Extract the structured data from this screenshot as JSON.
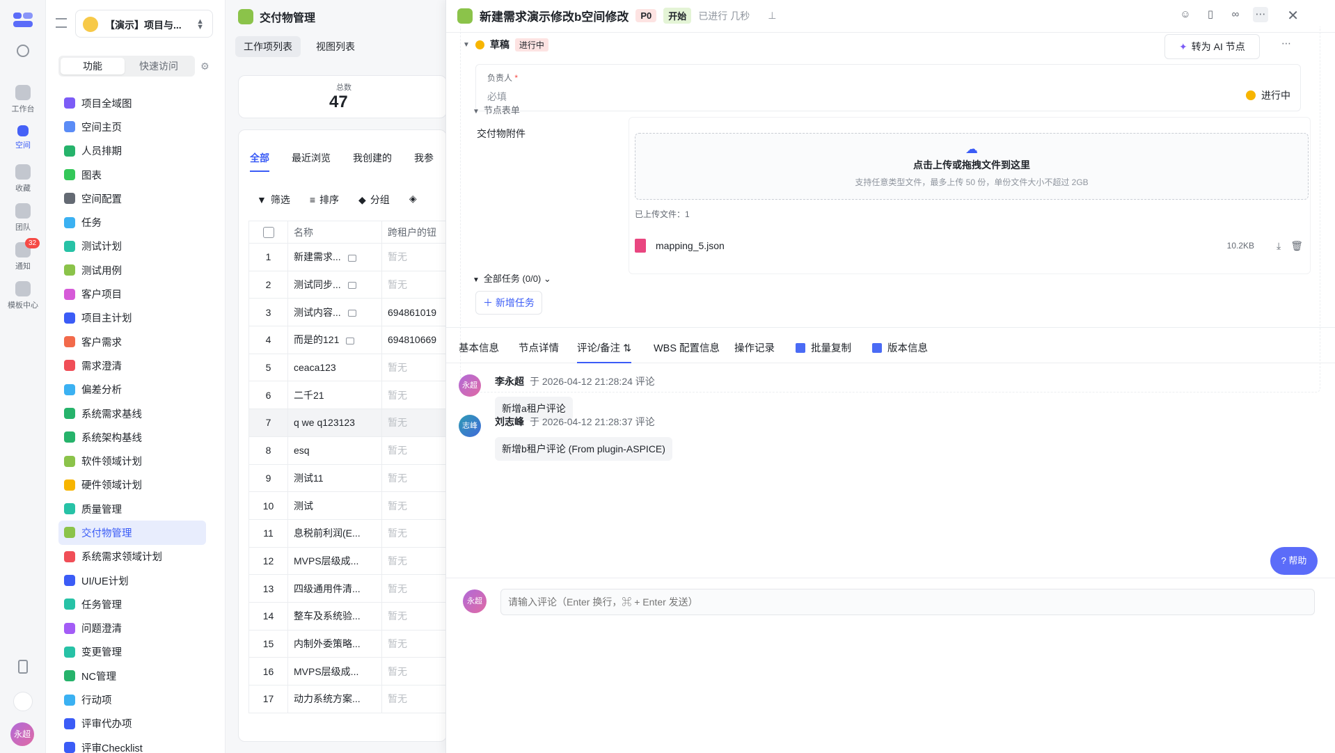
{
  "rail": {
    "items": [
      {
        "label": "",
        "icon": "search-icon"
      },
      {
        "label": "工作台",
        "icon": "home-icon"
      },
      {
        "label": "空间",
        "icon": "space-icon"
      },
      {
        "label": "收藏",
        "icon": "star-icon"
      },
      {
        "label": "团队",
        "icon": "team-icon"
      },
      {
        "label": "通知",
        "icon": "bell-icon",
        "badge": "32"
      },
      {
        "label": "模板中心",
        "icon": "template-icon"
      }
    ],
    "avatar": "永超"
  },
  "nav": {
    "project": "【演示】项目与...",
    "seg_on": "功能",
    "seg_off": "快速访问",
    "items": [
      {
        "label": "项目全域图",
        "color": "#7c5cf6"
      },
      {
        "label": "空间主页",
        "color": "#5b8cf6"
      },
      {
        "label": "人员排期",
        "color": "#26b36b"
      },
      {
        "label": "图表",
        "color": "#34c759"
      },
      {
        "label": "空间配置",
        "color": "#646a73"
      },
      {
        "label": "任务",
        "color": "#3bb1f2"
      },
      {
        "label": "测试计划",
        "color": "#27c2a6"
      },
      {
        "label": "测试用例",
        "color": "#8bc34a"
      },
      {
        "label": "客户项目",
        "color": "#d65ad8"
      },
      {
        "label": "项目主计划",
        "color": "#3b5cf6"
      },
      {
        "label": "客户需求",
        "color": "#f26a4b"
      },
      {
        "label": "需求澄清",
        "color": "#f04e57"
      },
      {
        "label": "偏差分析",
        "color": "#3bb1f2"
      },
      {
        "label": "系统需求基线",
        "color": "#26b36b"
      },
      {
        "label": "系统架构基线",
        "color": "#26b36b"
      },
      {
        "label": "软件领域计划",
        "color": "#8bc34a"
      },
      {
        "label": "硬件领域计划",
        "color": "#f7b500"
      },
      {
        "label": "质量管理",
        "color": "#27c2a6"
      },
      {
        "label": "交付物管理",
        "color": "#8bc34a",
        "active": true
      },
      {
        "label": "系统需求领域计划",
        "color": "#f04e57"
      },
      {
        "label": "UI/UE计划",
        "color": "#3b5cf6"
      },
      {
        "label": "任务管理",
        "color": "#27c2a6"
      },
      {
        "label": "问题澄清",
        "color": "#a35cf6"
      },
      {
        "label": "变更管理",
        "color": "#27c2a6"
      },
      {
        "label": "NC管理",
        "color": "#26b36b"
      },
      {
        "label": "行动项",
        "color": "#3bb1f2"
      },
      {
        "label": "评审代办项",
        "color": "#3b5cf6"
      },
      {
        "label": "评审Checklist",
        "color": "#3b5cf6"
      }
    ]
  },
  "mid": {
    "title": "交付物管理",
    "tabs": [
      "工作项列表",
      "视图列表"
    ],
    "total_label": "总数",
    "total": "47",
    "filter_tabs": [
      "全部",
      "最近浏览",
      "我创建的",
      "我参"
    ],
    "tools": {
      "filter": "筛选",
      "sort": "排序",
      "group": "分组"
    },
    "columns": {
      "name": "名称",
      "tenant": "跨租户的钮"
    },
    "rows": [
      {
        "no": "1",
        "name": "新建需求...",
        "cmt": true,
        "tenant": "暂无"
      },
      {
        "no": "2",
        "name": "测试同步...",
        "cmt": true,
        "tenant": "暂无"
      },
      {
        "no": "3",
        "name": "测试内容...",
        "cmt": true,
        "tenant": "694861019"
      },
      {
        "no": "4",
        "name": "而是的121",
        "cmt": true,
        "tenant": "694810669"
      },
      {
        "no": "5",
        "name": "ceaca123",
        "cmt": false,
        "tenant": "暂无"
      },
      {
        "no": "6",
        "name": "二千21",
        "cmt": false,
        "tenant": "暂无"
      },
      {
        "no": "7",
        "name": "q we q123123",
        "cmt": false,
        "tenant": "暂无",
        "hl": true
      },
      {
        "no": "8",
        "name": "esq",
        "cmt": false,
        "tenant": "暂无"
      },
      {
        "no": "9",
        "name": "测试11",
        "cmt": false,
        "tenant": "暂无"
      },
      {
        "no": "10",
        "name": "测试",
        "cmt": false,
        "tenant": "暂无"
      },
      {
        "no": "11",
        "name": "息税前利润(E...",
        "cmt": false,
        "tenant": "暂无"
      },
      {
        "no": "12",
        "name": "MVPS层级成...",
        "cmt": false,
        "tenant": "暂无"
      },
      {
        "no": "13",
        "name": "四级通用件清...",
        "cmt": false,
        "tenant": "暂无"
      },
      {
        "no": "14",
        "name": "整车及系统验...",
        "cmt": false,
        "tenant": "暂无"
      },
      {
        "no": "15",
        "name": "内制外委策略...",
        "cmt": false,
        "tenant": "暂无"
      },
      {
        "no": "16",
        "name": "MVPS层级成...",
        "cmt": false,
        "tenant": "暂无"
      },
      {
        "no": "17",
        "name": "动力系统方案...",
        "cmt": false,
        "tenant": "暂无"
      }
    ]
  },
  "panel": {
    "title": "新建需求演示修改b空间修改",
    "priority": "P0",
    "status": "开始",
    "elapsed": "已进行 几秒",
    "stage": "草稿",
    "stage_tag": "进行中",
    "ai_btn": "转为 AI 节点",
    "assignee_label": "负责人",
    "required": "*",
    "assignee_placeholder": "必填",
    "assignee_status": "进行中",
    "form_section": "节点表单",
    "attachment_label": "交付物附件",
    "upload_title": "点击上传或拖拽文件到这里",
    "upload_hint": "支持任意类型文件，最多上传 50 份，单份文件大小不超过 2GB",
    "uploaded_count": "已上传文件：1",
    "file": {
      "name": "mapping_5.json",
      "size": "10.2KB"
    },
    "tasks_section": "全部任务 (0/0)",
    "add_task": "新增任务",
    "bottom_tabs": [
      "基本信息",
      "节点详情",
      "评论/备注",
      "WBS 配置信息",
      "操作记录",
      "批量复制",
      "版本信息"
    ],
    "comments": [
      {
        "avatar": "永超",
        "author": "李永超",
        "time": "于 2026-04-12 21:28:24 评论",
        "text": "新增a租户评论"
      },
      {
        "avatar": "志峰",
        "author": "刘志峰",
        "time": "于 2026-04-12 21:28:37 评论",
        "text": "新增b租户评论 (From plugin-ASPICE)"
      }
    ],
    "help": "帮助",
    "composer_avatar": "永超",
    "composer_placeholder": "请输入评论（Enter 换行，⌘ + Enter 发送）"
  }
}
